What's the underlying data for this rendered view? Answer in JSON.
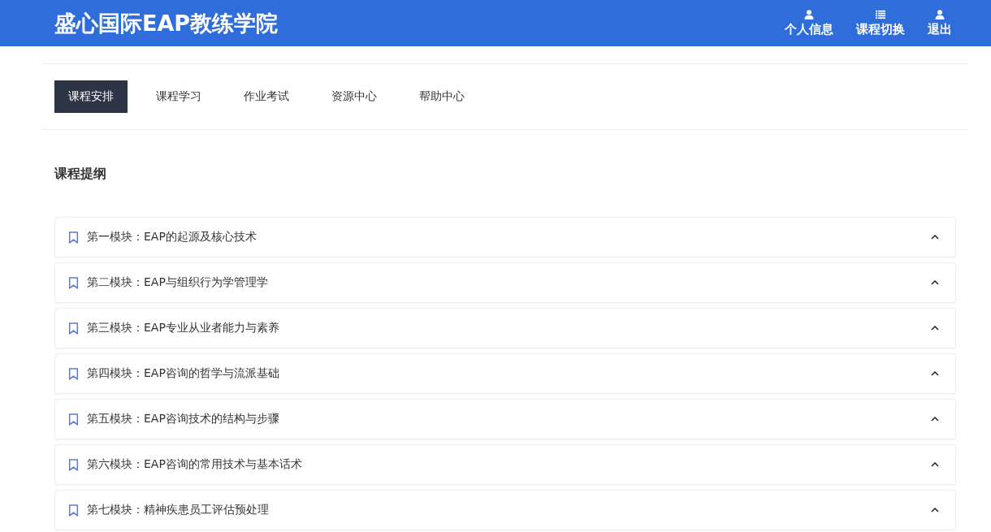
{
  "header": {
    "title": "盛心国际EAP教练学院",
    "nav": [
      {
        "label": "个人信息",
        "kind": "user"
      },
      {
        "label": "课程切换",
        "kind": "list"
      },
      {
        "label": "退出",
        "kind": "user"
      }
    ]
  },
  "tabs": [
    {
      "label": "课程安排",
      "selected": true
    },
    {
      "label": "课程学习",
      "selected": false
    },
    {
      "label": "作业考试",
      "selected": false
    },
    {
      "label": "资源中心",
      "selected": false
    },
    {
      "label": "帮助中心",
      "selected": false
    }
  ],
  "section": {
    "title": "课程提纲",
    "modules": [
      {
        "title": "第一模块：EAP的起源及核心技术"
      },
      {
        "title": "第二模块：EAP与组织行为学管理学"
      },
      {
        "title": "第三模块：EAP专业从业者能力与素养"
      },
      {
        "title": "第四模块：EAP咨询的哲学与流派基础"
      },
      {
        "title": "第五模块：EAP咨询技术的结构与步骤"
      },
      {
        "title": "第六模块：EAP咨询的常用技术与基本话术"
      },
      {
        "title": "第七模块：精神疾患员工评估预处理"
      }
    ]
  }
}
